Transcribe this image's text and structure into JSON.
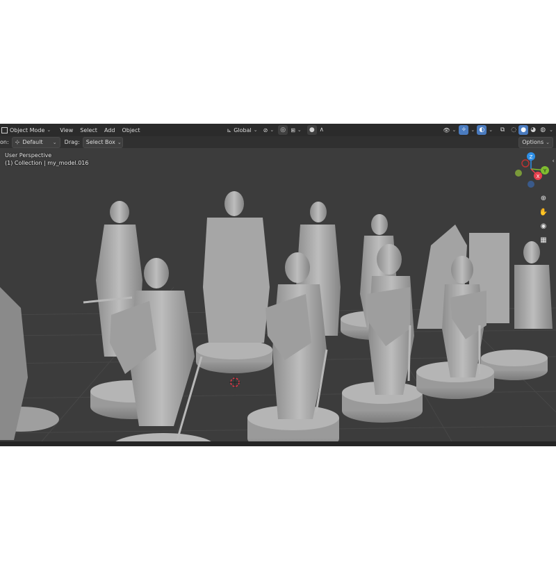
{
  "header": {
    "mode_label": "Object Mode",
    "menu": [
      "View",
      "Select",
      "Add",
      "Object"
    ],
    "orientation_label": "Global"
  },
  "tool_settings": {
    "orientation_prefix": "on:",
    "orientation_value": "Default",
    "drag_label": "Drag:",
    "drag_value": "Select Box",
    "options_label": "Options"
  },
  "viewport": {
    "perspective_label": "User Perspective",
    "collection_label": "(1) Collection | my_model.016",
    "gizmo_axes": {
      "z": "Z",
      "y": "Y",
      "x": "X"
    }
  },
  "colors": {
    "accent": "#4a7bbf",
    "axis_x": "#e8414f",
    "axis_y": "#7fbd2f",
    "axis_z": "#2e8fe6"
  },
  "icons": [
    "transform-pivot-icon",
    "snap-icon",
    "proportional-edit-icon",
    "visibility-icon",
    "gizmo-icon",
    "overlay-icon",
    "xray-icon",
    "wireframe-shading-icon",
    "solid-shading-icon",
    "material-shading-icon",
    "rendered-shading-icon",
    "zoom-icon",
    "pan-icon",
    "camera-icon",
    "grid-icon"
  ]
}
